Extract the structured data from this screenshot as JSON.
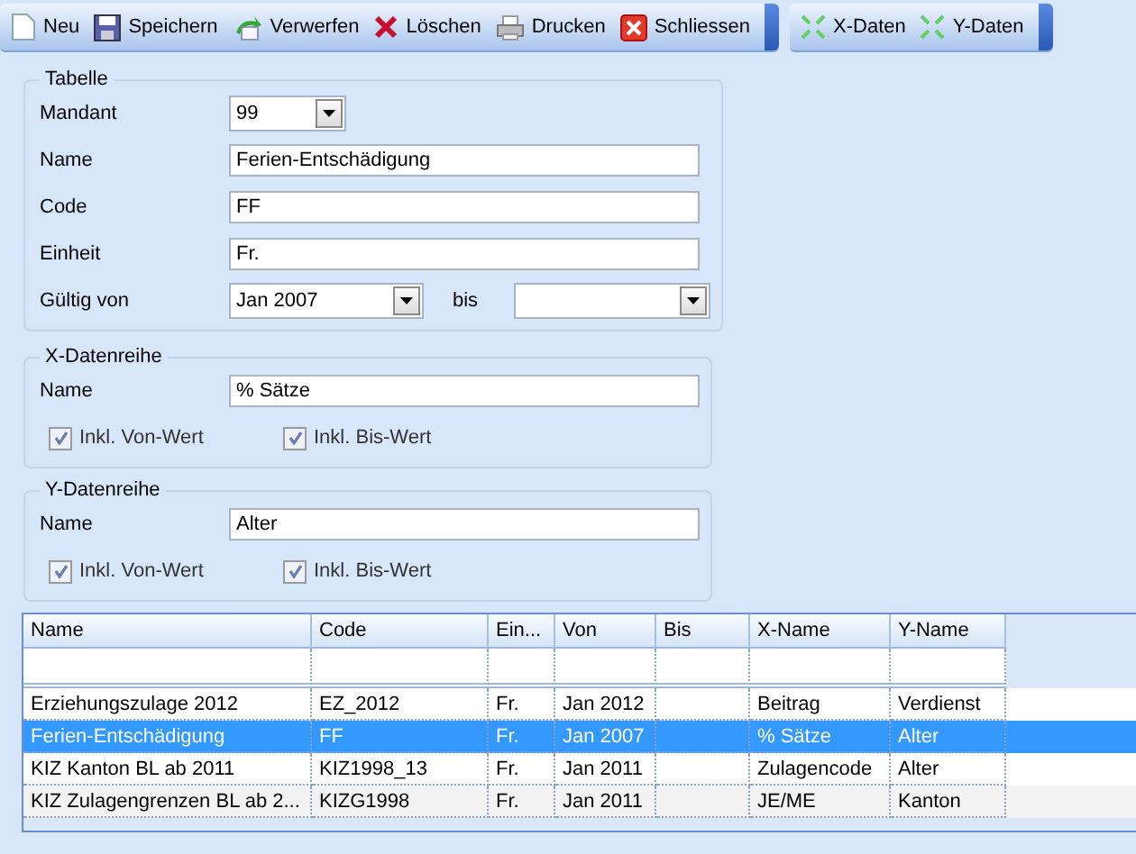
{
  "toolbars": [
    {
      "items": [
        {
          "label": "Neu"
        },
        {
          "label": "Speichern"
        },
        {
          "label": "Verwerfen"
        },
        {
          "label": "Löschen"
        },
        {
          "label": "Drucken"
        },
        {
          "label": "Schliessen"
        }
      ]
    },
    {
      "items": [
        {
          "label": "X-Daten"
        },
        {
          "label": "Y-Daten"
        }
      ]
    }
  ],
  "tabelle": {
    "title": "Tabelle",
    "fields": [
      {
        "label": "Mandant",
        "value": "99",
        "kind": "combo-short"
      },
      {
        "label": "Name",
        "value": "Ferien-Entschädigung",
        "kind": "text"
      },
      {
        "label": "Code",
        "value": "FF",
        "kind": "text"
      },
      {
        "label": "Einheit",
        "value": "Fr.",
        "kind": "text"
      },
      {
        "label": "Gültig von",
        "value": "Jan 2007",
        "kind": "range",
        "to_label": "bis"
      }
    ]
  },
  "series": [
    {
      "title": "X-Datenreihe",
      "name_label": "Name",
      "name_value": "% Sätze",
      "checks": [
        {
          "label": "Inkl. Von-Wert",
          "checked": true
        },
        {
          "label": "Inkl. Bis-Wert",
          "checked": true
        }
      ]
    },
    {
      "title": "Y-Datenreihe",
      "name_label": "Name",
      "name_value": "Alter",
      "checks": [
        {
          "label": "Inkl. Von-Wert",
          "checked": true
        },
        {
          "label": "Inkl. Bis-Wert",
          "checked": true
        }
      ]
    }
  ],
  "table": {
    "columns": [
      "Name",
      "Code",
      "Ein...",
      "Von",
      "Bis",
      "X-Name",
      "Y-Name"
    ],
    "rows": [
      {
        "cells": [
          "Erziehungszulage 2012",
          "EZ_2012",
          "Fr.",
          "Jan 2012",
          "",
          "Beitrag",
          "Verdienst"
        ],
        "selected": false
      },
      {
        "cells": [
          "Ferien-Entschädigung",
          "FF",
          "Fr.",
          "Jan 2007",
          "",
          "% Sätze",
          "Alter"
        ],
        "selected": true
      },
      {
        "cells": [
          "KIZ Kanton BL ab 2011",
          "KIZ1998_13",
          "Fr.",
          "Jan 2011",
          "",
          "Zulagencode",
          "Alter"
        ],
        "selected": false
      },
      {
        "cells": [
          "KIZ Zulagengrenzen BL ab 2...",
          "KIZG1998",
          "Fr.",
          "Jan 2011",
          "",
          "JE/ME",
          "Kanton"
        ],
        "selected": false
      }
    ]
  }
}
